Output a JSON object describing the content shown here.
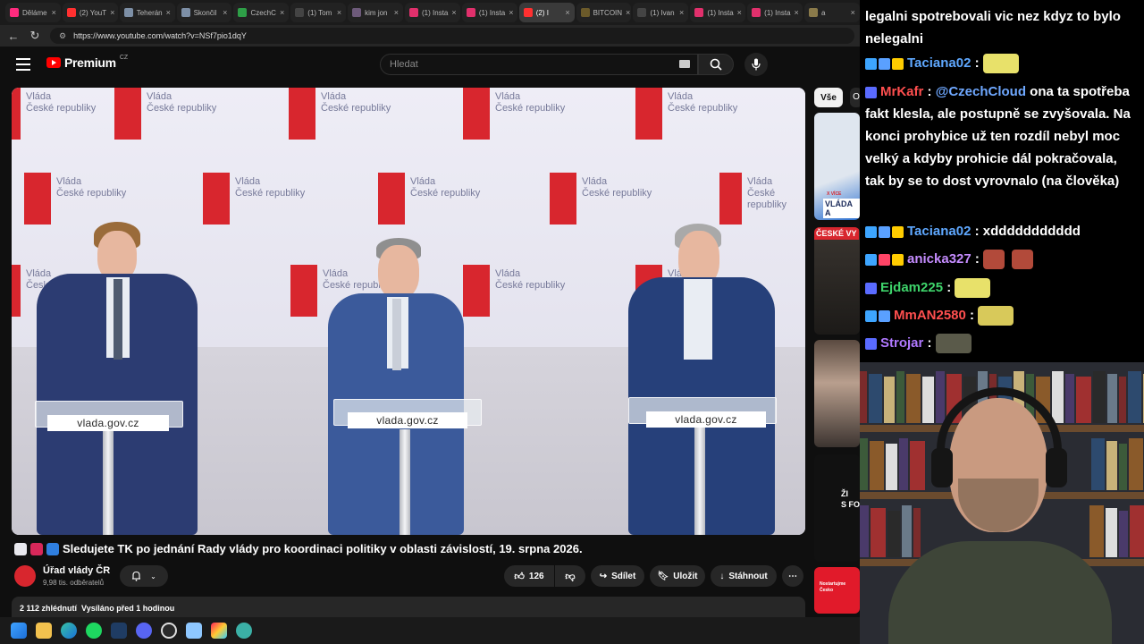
{
  "browser": {
    "tabs": [
      {
        "label": "Děláme",
        "color": "#ff2b7e"
      },
      {
        "label": "(2) YouT",
        "color": "#ff3030"
      },
      {
        "label": "Teherán",
        "color": "#7d8fa6"
      },
      {
        "label": "Skončil",
        "color": "#7d8fa6"
      },
      {
        "label": "CzechC",
        "color": "#2e9e47"
      },
      {
        "label": "(1) Tom",
        "color": "#444"
      },
      {
        "label": "kim jon",
        "color": "#6d5a7a"
      },
      {
        "label": "(1) Insta",
        "color": "#e1306c"
      },
      {
        "label": "(1) Insta",
        "color": "#e1306c"
      },
      {
        "label": "(2) I",
        "color": "#ff3030"
      },
      {
        "label": "BITCOIN",
        "color": "#6b5a2a"
      },
      {
        "label": "(1) Ivan",
        "color": "#444"
      },
      {
        "label": "(1) Insta",
        "color": "#e1306c"
      },
      {
        "label": "(1) Insta",
        "color": "#e1306c"
      },
      {
        "label": "a",
        "color": "#8a7a4a"
      }
    ],
    "url": "https://www.youtube.com/watch?v=NSf7pio1dqY"
  },
  "youtube": {
    "logo_text": "Premium",
    "logo_country": "CZ",
    "search_placeholder": "Hledat"
  },
  "video": {
    "backdrop_logo_line1": "Vláda",
    "backdrop_logo_line2": "České republiky",
    "podium_sign": "vlada.gov.cz",
    "title": "Sledujete TK po jednání Rady vlády pro koordinaci politiky v oblasti závislostí, 19. srpna 2026.",
    "channel": "Úřad vlády ČR",
    "subscribers": "9,98 tis. odběratelů",
    "likes": "126",
    "share": "Sdílet",
    "save": "Uložit",
    "download": "Stáhnout",
    "views": "2 112 zhlédnutí",
    "streamed": "Vysíláno před 1 hodinou"
  },
  "sidebar": {
    "chip_all": "Vše",
    "chip_next": "O",
    "thumb1_label": "VLÁDA A",
    "thumb1_tag": "X VÍCE",
    "thumb2_label": "ČESKÉ VY",
    "thumb4_label": "ŽI\nS FO",
    "thumb5_label": "Nostartujme Česko"
  },
  "chat": {
    "partial_top": "legalni spotrebovali vic nez kdyz to bylo nelegalni",
    "messages": [
      {
        "user": "Taciana02",
        "color": "#5fa8ff",
        "text": "",
        "badges": [
          "#3da5ff",
          "#5aa0ff",
          "#ffcc00"
        ],
        "emote": "#e8e16a"
      },
      {
        "user": "MrKafr",
        "color": "#ff4f4f",
        "text": "@CzechCloud ona ta spotřeba fakt klesla, ale postupně se zvyšovala. Na konci prohybice už ten rozdíl nebyl moc velký a kdyby prohicie dál pokračovala, tak by se to dost vyrovnalo (na člověka)",
        "mention": "@CzechCloud",
        "badges": [
          "#5a6bff"
        ]
      },
      {
        "user": "Taciana02",
        "color": "#5fa8ff",
        "text": "xddddddddddd",
        "badges": [
          "#3da5ff",
          "#5aa0ff",
          "#ffcc00"
        ]
      },
      {
        "user": "anicka327",
        "color": "#c58cff",
        "text": "",
        "badges": [
          "#3da5ff",
          "#ff4466",
          "#ffcc00"
        ],
        "emote": "#b24a3a"
      },
      {
        "user": "Ejdam225",
        "color": "#3ed46b",
        "text": "",
        "badges": [
          "#5a6bff"
        ],
        "emote": "#e8e16a"
      },
      {
        "user": "MmAN2580",
        "color": "#ff4f4f",
        "text": "",
        "badges": [
          "#3da5ff",
          "#5aa0ff"
        ],
        "emote": "#d8c95a"
      },
      {
        "user": "Strojar",
        "color": "#b078ff",
        "text": "",
        "badges": [
          "#5a6bff"
        ],
        "emote": "#5a5a4a"
      }
    ]
  }
}
